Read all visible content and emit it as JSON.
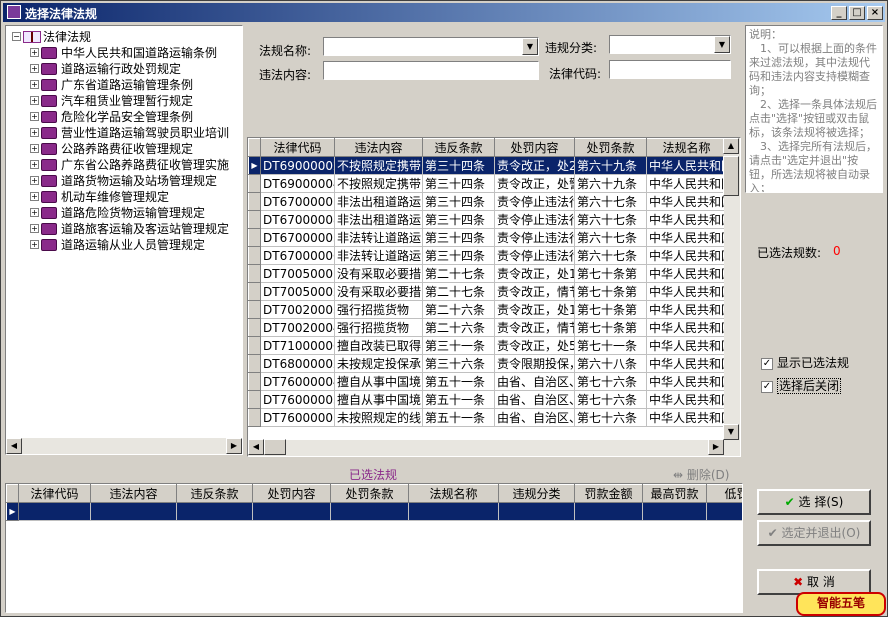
{
  "window": {
    "title": "选择法律法规"
  },
  "tree": {
    "root_label": "法律法规",
    "items": [
      "中华人民共和国道路运输条例",
      "道路运输行政处罚规定",
      "广东省道路运输管理条例",
      "汽车租赁业管理暂行规定",
      "危险化学品安全管理条例",
      "营业性道路运输驾驶员职业培训",
      "公路养路费征收管理规定",
      "广东省公路养路费征收管理实施",
      "道路货物运输及站场管理规定",
      "机动车维修管理规定",
      "道路危险货物运输管理规定",
      "道路旅客运输及客运站管理规定",
      "道路运输从业人员管理规定"
    ]
  },
  "filters": {
    "name_label": "法规名称:",
    "category_label": "违规分类:",
    "content_label": "违法内容:",
    "code_label": "法律代码:"
  },
  "grid": {
    "columns": [
      "法律代码",
      "违法内容",
      "违反条款",
      "处罚内容",
      "处罚条款",
      "法规名称"
    ],
    "rows": [
      [
        "DT69000002",
        "不按照规定携带",
        "第三十四条",
        "责令改正，处2",
        "第六十九条",
        "中华人民共和国"
      ],
      [
        "DT69000004",
        "不按照规定携带",
        "第三十四条",
        "责令改正，处警",
        "第六十九条",
        "中华人民共和国"
      ],
      [
        "DT67000007",
        "非法出租道路运",
        "第三十四条",
        "责令停止违法行",
        "第六十七条",
        "中华人民共和国"
      ],
      [
        "DT67000008",
        "非法出租道路运",
        "第三十四条",
        "责令停止违法行",
        "第六十七条",
        "中华人民共和国"
      ],
      [
        "DT67000005",
        "非法转让道路运",
        "第三十四条",
        "责令停止违法行",
        "第六十七条",
        "中华人民共和国"
      ],
      [
        "DT67000006",
        "非法转让道路运",
        "第三十四条",
        "责令停止违法行",
        "第六十七条",
        "中华人民共和国"
      ],
      [
        "DT70050001",
        "没有采取必要措",
        "第二十七条",
        "责令改正，处1",
        "第七十条第",
        "中华人民共和国"
      ],
      [
        "DT70050002",
        "没有采取必要措",
        "第二十七条",
        "责令改正，情节",
        "第七十条第",
        "中华人民共和国"
      ],
      [
        "DT70020003",
        "强行招揽货物",
        "第二十六条",
        "责令改正，处1",
        "第七十条第",
        "中华人民共和国"
      ],
      [
        "DT70020004",
        "强行招揽货物",
        "第二十六条",
        "责令改正，情节",
        "第七十条第",
        "中华人民共和国"
      ],
      [
        "DT71000006",
        "擅自改装已取得",
        "第三十一条",
        "责令改正，处5",
        "第七十一条",
        "中华人民共和国"
      ],
      [
        "DT68000002",
        "未按规定投保承",
        "第三十六条",
        "责令限期投保，",
        "第六十八条",
        "中华人民共和国"
      ],
      [
        "DT76000004",
        "擅自从事中国境",
        "第五十一条",
        "由省、自治区、",
        "第七十六条",
        "中华人民共和国"
      ],
      [
        "DT76000003",
        "擅自从事中国境",
        "第五十一条",
        "由省、自治区、",
        "第七十六条",
        "中华人民共和国"
      ],
      [
        "DT76000001",
        "未按照规定的线",
        "第五十一条",
        "由省、自治区、",
        "第七十六条",
        "中华人民共和国"
      ]
    ]
  },
  "selected": {
    "title": "已选法规",
    "delete_label": "删除(D)",
    "columns": [
      "法律代码",
      "违法内容",
      "违反条款",
      "处罚内容",
      "处罚条款",
      "法规名称",
      "违规分类",
      "罚款金额",
      "最高罚款",
      "低罚"
    ]
  },
  "notes": {
    "title": "说明：",
    "lines": [
      "　1、可以根据上面的条件来过滤法规，其中法规代码和违法内容支持模糊查询；",
      "　2、选择一条具体法规后点击\"选择\"按钮或双击鼠标，该条法规将被选择；",
      "　3、选择完所有法规后，请点击\"选定并退出\"按钮，所选法规将被自动录入；"
    ]
  },
  "count": {
    "label": "已选法规数:",
    "value": "0"
  },
  "options": {
    "show_selected": "显示已选法规",
    "close_after": "选择后关闭"
  },
  "buttons": {
    "select": "选 择(S)",
    "select_exit": "选定并退出(O)",
    "cancel": "取 消"
  },
  "logo": "智能五笔",
  "colors": {
    "title_start": "#0a246a",
    "selection": "#0a246a",
    "count_value": "#ff0000",
    "accent_purple": "#8a2a8a"
  }
}
